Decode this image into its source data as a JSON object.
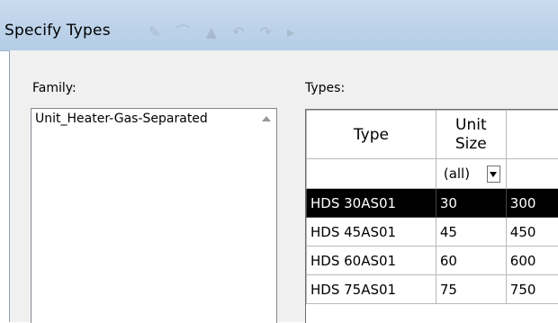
{
  "window": {
    "title": "Specify Types"
  },
  "family": {
    "label": "Family:",
    "items": [
      "Unit_Heater-Gas-Separated"
    ]
  },
  "types": {
    "label": "Types:",
    "columns": [
      "Type",
      "Unit\nSize"
    ],
    "filter": {
      "value": "(all)"
    },
    "rows": [
      {
        "type": "HDS 30AS01",
        "unit_size": "30",
        "extra": "300",
        "selected": true
      },
      {
        "type": "HDS 45AS01",
        "unit_size": "45",
        "extra": "450",
        "selected": false
      },
      {
        "type": "HDS 60AS01",
        "unit_size": "60",
        "extra": "600",
        "selected": false
      },
      {
        "type": "HDS 75AS01",
        "unit_size": "75",
        "extra": "750",
        "selected": false
      }
    ]
  },
  "colors": {
    "titlebar": "#bfd4ea",
    "selection": "#000000",
    "dialog": "#f0f0f0"
  }
}
